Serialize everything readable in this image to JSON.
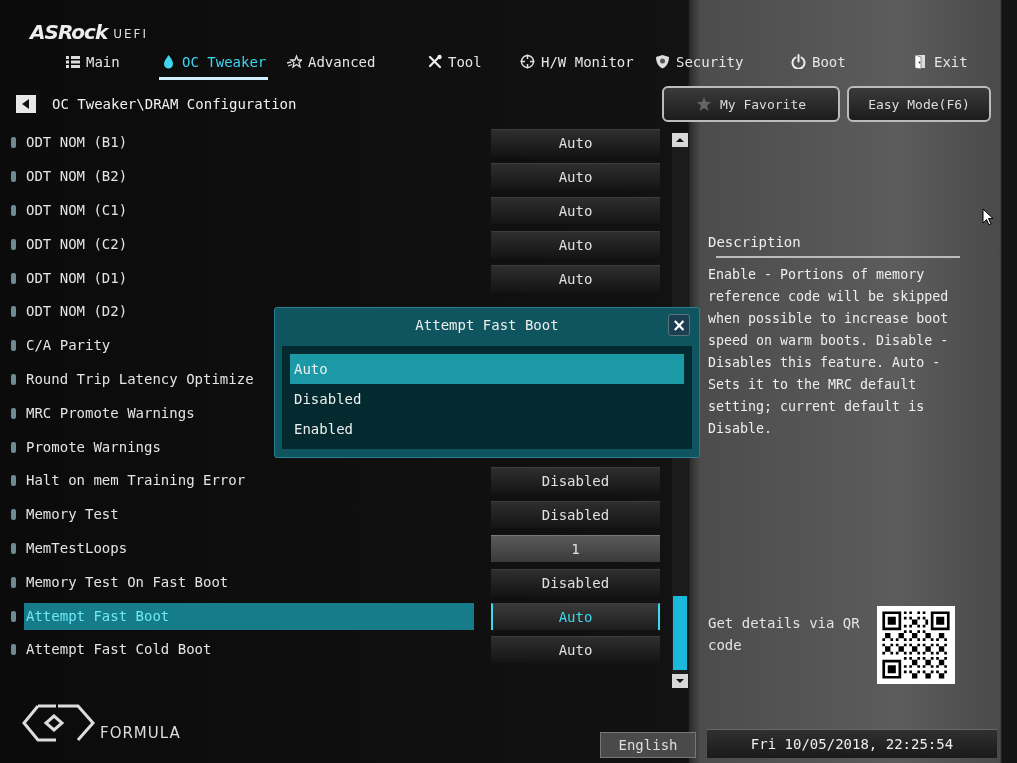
{
  "logo": {
    "brand": "ASRock",
    "suffix": "UEFI"
  },
  "tabs": [
    {
      "label": "Main",
      "selected": false
    },
    {
      "label": "OC Tweaker",
      "selected": true
    },
    {
      "label": "Advanced",
      "selected": false
    },
    {
      "label": "Tool",
      "selected": false
    },
    {
      "label": "H/W Monitor",
      "selected": false
    },
    {
      "label": "Security",
      "selected": false
    },
    {
      "label": "Boot",
      "selected": false
    },
    {
      "label": "Exit",
      "selected": false
    }
  ],
  "breadcrumb": {
    "path": "OC Tweaker\\DRAM Configuration"
  },
  "header_buttons": {
    "favorite": "My Favorite",
    "easy_mode": "Easy Mode(F6)"
  },
  "settings": [
    {
      "label": "ODT NOM (B1)",
      "value": "Auto",
      "kind": "option",
      "selected": false
    },
    {
      "label": "ODT NOM (B2)",
      "value": "Auto",
      "kind": "option",
      "selected": false
    },
    {
      "label": "ODT NOM (C1)",
      "value": "Auto",
      "kind": "option",
      "selected": false
    },
    {
      "label": "ODT NOM (C2)",
      "value": "Auto",
      "kind": "option",
      "selected": false
    },
    {
      "label": "ODT NOM (D1)",
      "value": "Auto",
      "kind": "option",
      "selected": false
    },
    {
      "label": "ODT NOM (D2)",
      "selected": false
    },
    {
      "label": "C/A Parity",
      "selected": false
    },
    {
      "label": "Round Trip Latency Optimize",
      "selected": false
    },
    {
      "label": "MRC Promote Warnings",
      "selected": false
    },
    {
      "label": "Promote Warnings",
      "selected": false
    },
    {
      "label": "Halt on mem Training Error",
      "value": "Disabled",
      "kind": "option",
      "selected": false
    },
    {
      "label": "Memory Test",
      "value": "Disabled",
      "kind": "option",
      "selected": false
    },
    {
      "label": "MemTestLoops",
      "value": "1",
      "kind": "number",
      "selected": false
    },
    {
      "label": "Memory Test On Fast Boot",
      "value": "Disabled",
      "kind": "option",
      "selected": false
    },
    {
      "label": "Attempt Fast Boot",
      "value": "Auto",
      "kind": "option",
      "selected": true
    },
    {
      "label": "Attempt Fast Cold Boot",
      "value": "Auto",
      "kind": "option",
      "selected": false
    }
  ],
  "popup": {
    "title": "Attempt Fast Boot",
    "close": "×",
    "options": [
      {
        "label": "Auto",
        "selected": true
      },
      {
        "label": "Disabled",
        "selected": false
      },
      {
        "label": "Enabled",
        "selected": false
      }
    ]
  },
  "description": {
    "title": "Description",
    "text": "Enable - Portions of memory reference code will be skipped when possible to increase boot speed on warm boots. Disable - Disables this feature. Auto - Sets it to the MRC default setting; current default is Disable."
  },
  "qr": {
    "text": "Get details via QR code"
  },
  "footer": {
    "brand": "FORMULA",
    "language": "English",
    "datetime": "Fri 10/05/2018, 22:25:54"
  }
}
